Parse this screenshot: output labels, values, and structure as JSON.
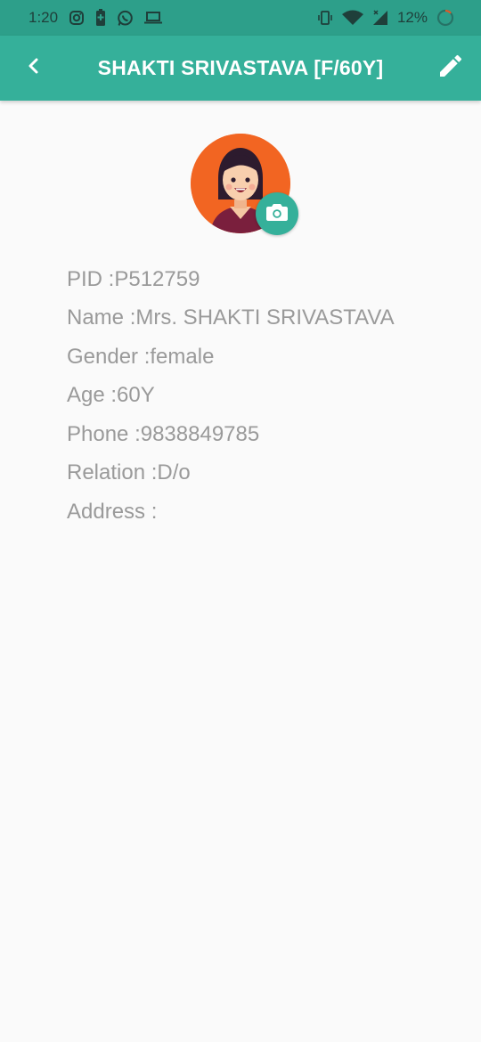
{
  "status_bar": {
    "time": "1:20",
    "battery_percent": "12%",
    "icons": [
      "instagram-icon",
      "battery-saver-icon",
      "whatsapp-icon",
      "laptop-icon",
      "vibrate-icon",
      "wifi-icon",
      "signal-icon",
      "battery-ring-icon"
    ]
  },
  "header": {
    "title": "SHAKTI SRIVASTAVA [F/60Y]",
    "back_icon": "chevron-left-icon",
    "edit_icon": "pencil-icon"
  },
  "profile": {
    "avatar_icon": "female-avatar-icon",
    "camera_icon": "camera-icon",
    "fields": [
      {
        "label": "PID :",
        "value": "P512759"
      },
      {
        "label": "Name :",
        "value": "Mrs. SHAKTI SRIVASTAVA"
      },
      {
        "label": "Gender :",
        "value": "female"
      },
      {
        "label": "Age :",
        "value": "60Y"
      },
      {
        "label": "Phone :",
        "value": "9838849785"
      },
      {
        "label": "Relation :",
        "value": "D/o"
      },
      {
        "label": "Address :",
        "value": ""
      }
    ]
  },
  "colors": {
    "status_bar": "#2d9f8a",
    "app_bar": "#35b09a",
    "avatar_bg": "#f26522",
    "text_gray": "#9a9a9a",
    "background": "#fafafa"
  }
}
